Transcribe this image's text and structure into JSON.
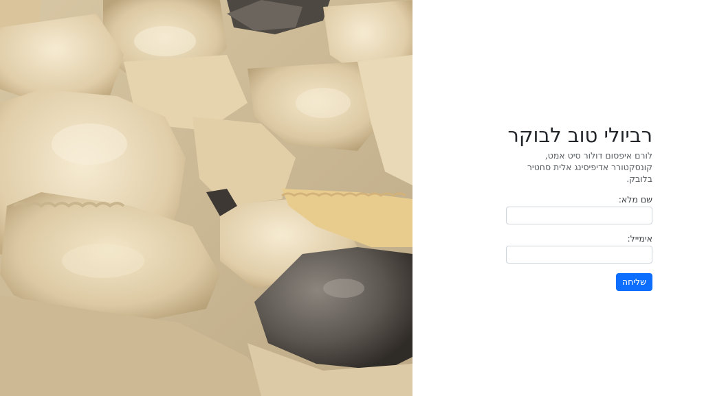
{
  "hero": {
    "image_name": "ravioli-photo",
    "colors": {
      "pasta": "#e7d6b4",
      "sauce": "#d3c2a1",
      "mushroom": "#5a5550",
      "shadow": "#8f7b5a"
    }
  },
  "form": {
    "title": "רביולי טוב לבוקר",
    "subtitle": "לורם איפסום דולור סיט אמט, קונסקטורר אדיפיסינג אלית סחטיר בלובק.",
    "name_label": "שם מלא:",
    "name_value": "",
    "name_placeholder": "",
    "email_label": "אימייל:",
    "email_value": "",
    "email_placeholder": "",
    "submit_label": "שליחה",
    "accent": "#0d6efd"
  }
}
